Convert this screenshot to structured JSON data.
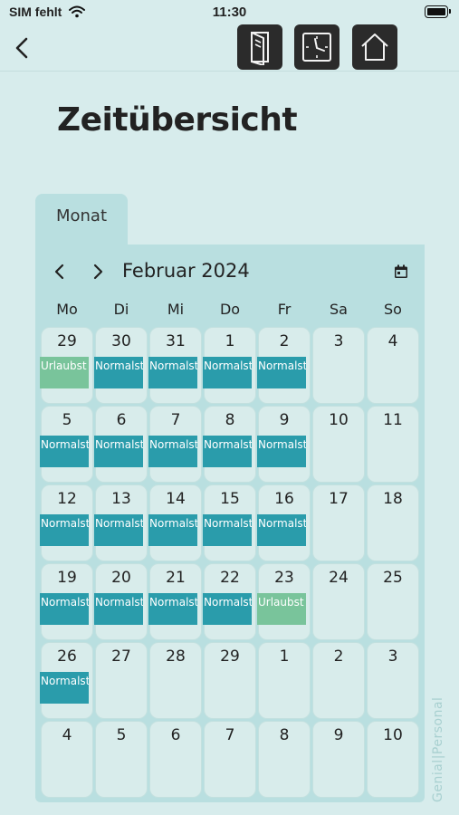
{
  "status": {
    "carrier": "SIM fehlt",
    "time": "11:30"
  },
  "nav": {
    "back_icon": "chevron-left-icon",
    "buttons": [
      "document-icon",
      "clock-icon",
      "home-icon"
    ]
  },
  "page": {
    "title": "Zeitübersicht"
  },
  "tab": {
    "label": "Monat"
  },
  "calendar": {
    "month": "Februar 2024",
    "weekdays": [
      "Mo",
      "Di",
      "Mi",
      "Do",
      "Fr",
      "Sa",
      "So"
    ],
    "weeks": [
      [
        {
          "day": "29",
          "event": "Urlaubst",
          "type": "vacation"
        },
        {
          "day": "30",
          "event": "Normalst",
          "type": "normal"
        },
        {
          "day": "31",
          "event": "Normalst",
          "type": "normal"
        },
        {
          "day": "1",
          "event": "Normalst",
          "type": "normal"
        },
        {
          "day": "2",
          "event": "Normalst",
          "type": "normal"
        },
        {
          "day": "3"
        },
        {
          "day": "4"
        }
      ],
      [
        {
          "day": "5",
          "event": "Normalst",
          "type": "normal"
        },
        {
          "day": "6",
          "event": "Normalst",
          "type": "normal"
        },
        {
          "day": "7",
          "event": "Normalst",
          "type": "normal"
        },
        {
          "day": "8",
          "event": "Normalst",
          "type": "normal"
        },
        {
          "day": "9",
          "event": "Normalst",
          "type": "normal"
        },
        {
          "day": "10"
        },
        {
          "day": "11"
        }
      ],
      [
        {
          "day": "12",
          "event": "Normalst",
          "type": "normal"
        },
        {
          "day": "13",
          "event": "Normalst",
          "type": "normal"
        },
        {
          "day": "14",
          "event": "Normalst",
          "type": "normal"
        },
        {
          "day": "15",
          "event": "Normalst",
          "type": "normal"
        },
        {
          "day": "16",
          "event": "Normalst",
          "type": "normal"
        },
        {
          "day": "17"
        },
        {
          "day": "18"
        }
      ],
      [
        {
          "day": "19",
          "event": "Normalst",
          "type": "normal"
        },
        {
          "day": "20",
          "event": "Normalst",
          "type": "normal"
        },
        {
          "day": "21",
          "event": "Normalst",
          "type": "normal"
        },
        {
          "day": "22",
          "event": "Normalst",
          "type": "normal"
        },
        {
          "day": "23",
          "event": "Urlaubst",
          "type": "vacation"
        },
        {
          "day": "24"
        },
        {
          "day": "25"
        }
      ],
      [
        {
          "day": "26",
          "event": "Normalst",
          "type": "normal"
        },
        {
          "day": "27"
        },
        {
          "day": "28"
        },
        {
          "day": "29"
        },
        {
          "day": "1"
        },
        {
          "day": "2"
        },
        {
          "day": "3"
        }
      ],
      [
        {
          "day": "4"
        },
        {
          "day": "5"
        },
        {
          "day": "6"
        },
        {
          "day": "7"
        },
        {
          "day": "8"
        },
        {
          "day": "9"
        },
        {
          "day": "10"
        }
      ]
    ]
  },
  "watermark": "Genial|Personal",
  "colors": {
    "background": "#d7ecec",
    "panel": "#b9dfe0",
    "cell": "#d8eceb",
    "normal_event": "#2a9cab",
    "vacation_event": "#79c49b",
    "nav_button": "#2b2b2b"
  }
}
